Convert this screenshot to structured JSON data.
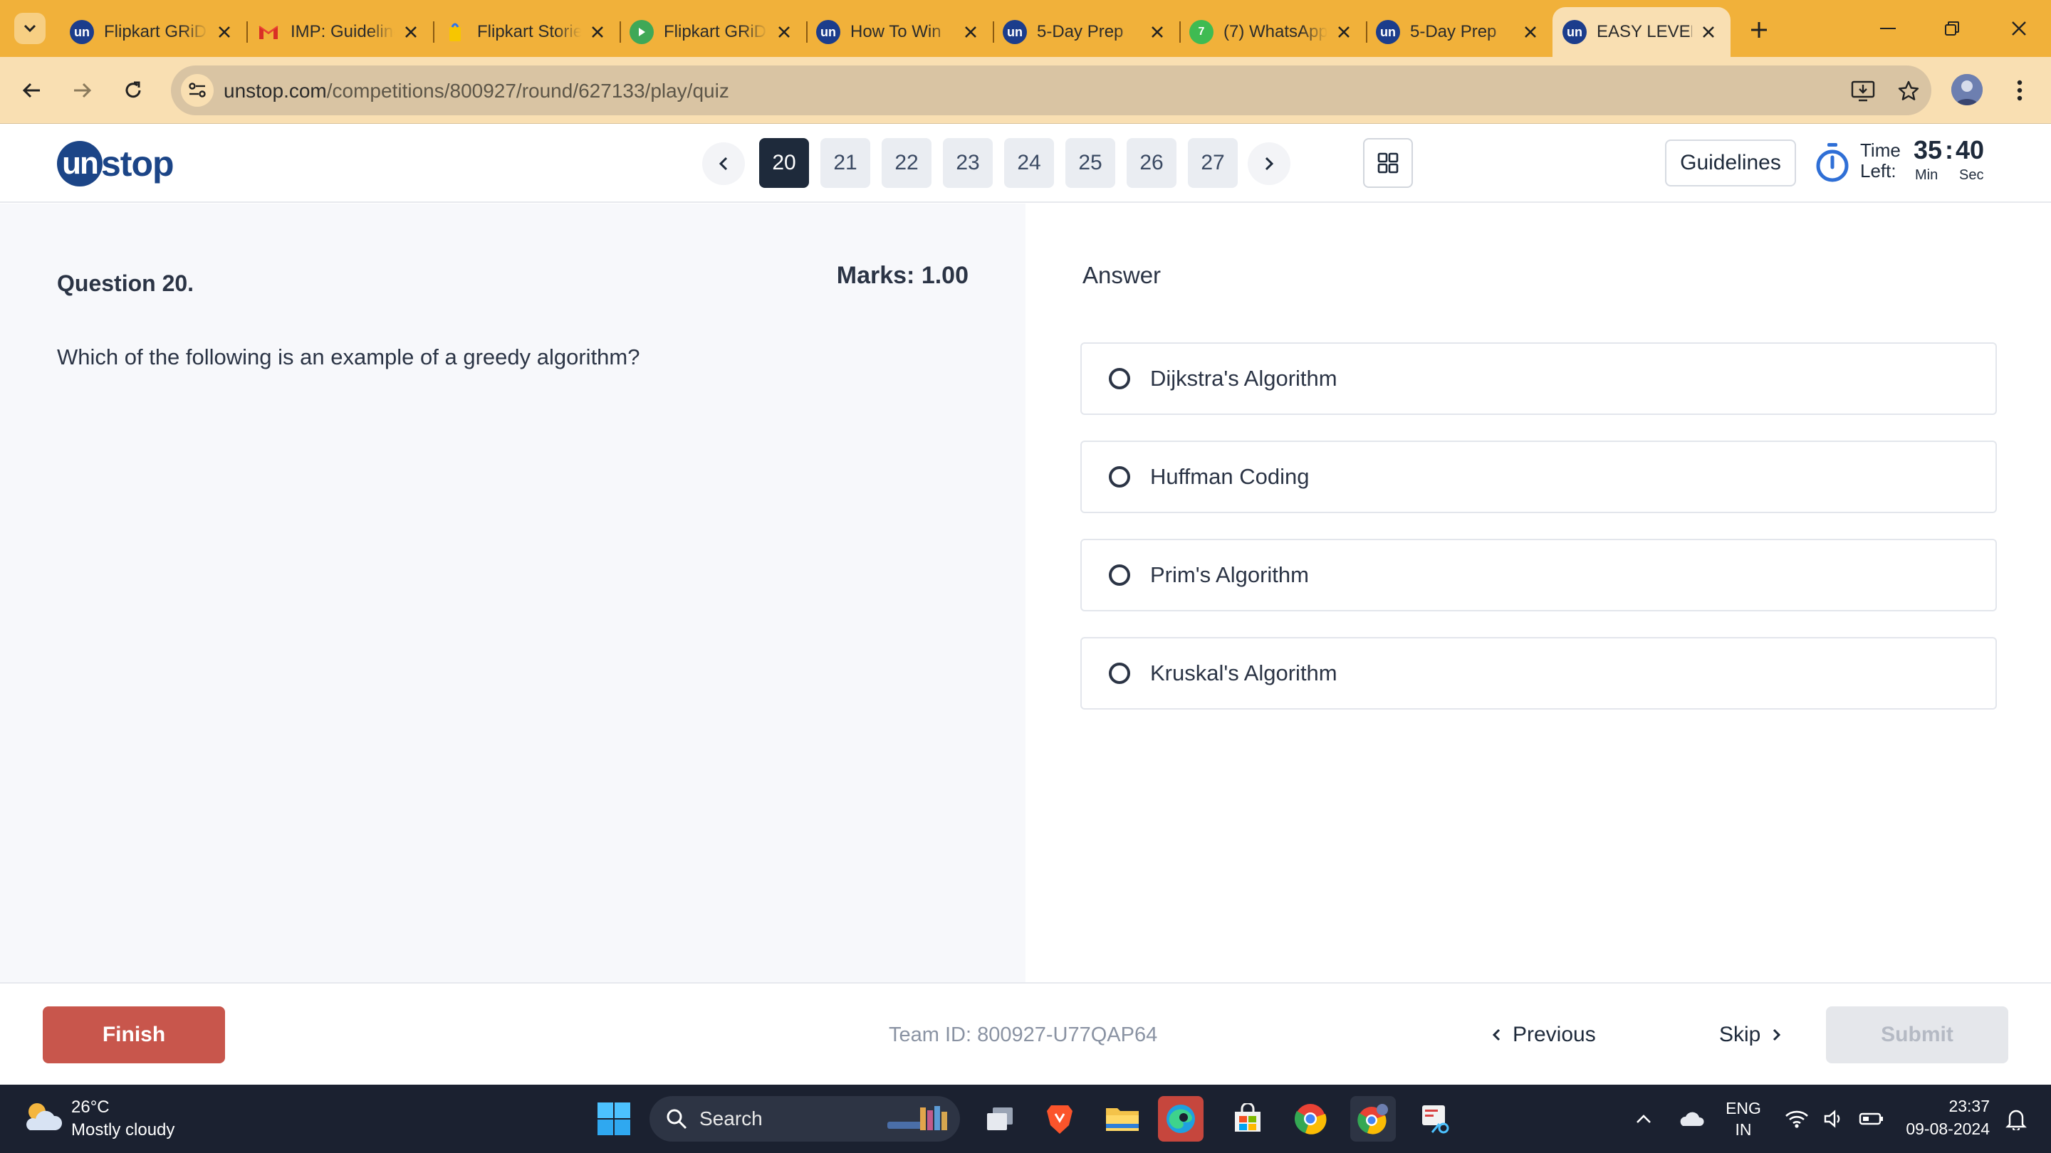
{
  "browser": {
    "tabs": [
      {
        "title": "Flipkart GRiD",
        "favicon": "unstop-favicon"
      },
      {
        "title": "IMP: Guidelines",
        "favicon": "gmail-favicon"
      },
      {
        "title": "Flipkart Stories",
        "favicon": "flipkart-favicon"
      },
      {
        "title": "Flipkart GRiD",
        "favicon": "green-play-favicon"
      },
      {
        "title": "How To Win",
        "favicon": "unstop-favicon"
      },
      {
        "title": "5-Day Prep",
        "favicon": "unstop-favicon"
      },
      {
        "title": "(7) WhatsApp",
        "favicon": "whatsapp-favicon"
      },
      {
        "title": "5-Day Prep",
        "favicon": "unstop-favicon"
      },
      {
        "title": "EASY LEVEL",
        "favicon": "unstop-favicon",
        "active": true
      }
    ],
    "url_host": "unstop.com",
    "url_path": "/competitions/800927/round/627133/play/quiz",
    "accent_color": "#f1b13a"
  },
  "header": {
    "logo_mark": "un",
    "logo_text": "stop",
    "question_numbers": [
      "20",
      "21",
      "22",
      "23",
      "24",
      "25",
      "26",
      "27"
    ],
    "current_question": "20",
    "guidelines_label": "Guidelines",
    "time_label_1": "Time",
    "time_label_2": "Left:",
    "minutes": "35",
    "seconds": "40",
    "min_label": "Min",
    "sec_label": "Sec"
  },
  "question": {
    "title": "Question 20.",
    "marks": "Marks: 1.00",
    "text": "Which of the following is an example of a greedy algorithm?"
  },
  "answer": {
    "label": "Answer",
    "options": [
      "Dijkstra's Algorithm",
      "Huffman Coding",
      "Prim's Algorithm",
      "Kruskal's Algorithm"
    ]
  },
  "footer": {
    "finish_label": "Finish",
    "team_id": "Team ID: 800927-U77QAP64",
    "previous_label": "Previous",
    "skip_label": "Skip",
    "submit_label": "Submit"
  },
  "taskbar": {
    "temperature": "26°C",
    "weather": "Mostly cloudy",
    "search_placeholder": "Search",
    "lang_1": "ENG",
    "lang_2": "IN",
    "time": "23:37",
    "date": "09-08-2024"
  }
}
